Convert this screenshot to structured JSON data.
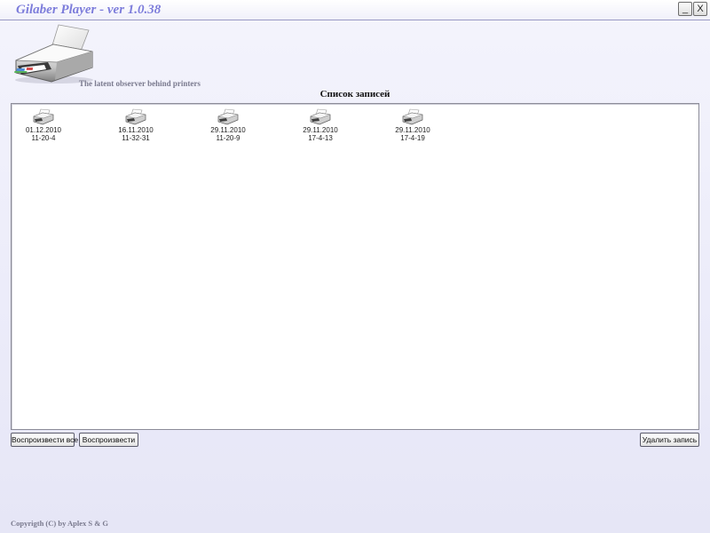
{
  "window": {
    "title": "Gilaber Player - ver 1.0.38",
    "minimize_label": "_",
    "close_label": "X"
  },
  "header": {
    "logo_icon": "printer-icon",
    "tagline": "The latent observer behind printers"
  },
  "records": {
    "title": "Список записей",
    "item_icon": "printer-icon",
    "items": [
      {
        "date": "01.12.2010",
        "time": "11-20-4"
      },
      {
        "date": "16.11.2010",
        "time": "11-32-31"
      },
      {
        "date": "29.11.2010",
        "time": "11-20-9"
      },
      {
        "date": "29.11.2010",
        "time": "17-4-13"
      },
      {
        "date": "29.11.2010",
        "time": "17-4-19"
      }
    ]
  },
  "buttons": {
    "play_all": "Воспроизвести все",
    "play": "Воспроизвести",
    "delete": "Удалить запись"
  },
  "footer": {
    "copyright": "Copyrigth (C) by Aplex S & G"
  },
  "colors": {
    "title_accent": "#7d7ddb",
    "background": "#ececfa",
    "panel": "#ffffff"
  }
}
